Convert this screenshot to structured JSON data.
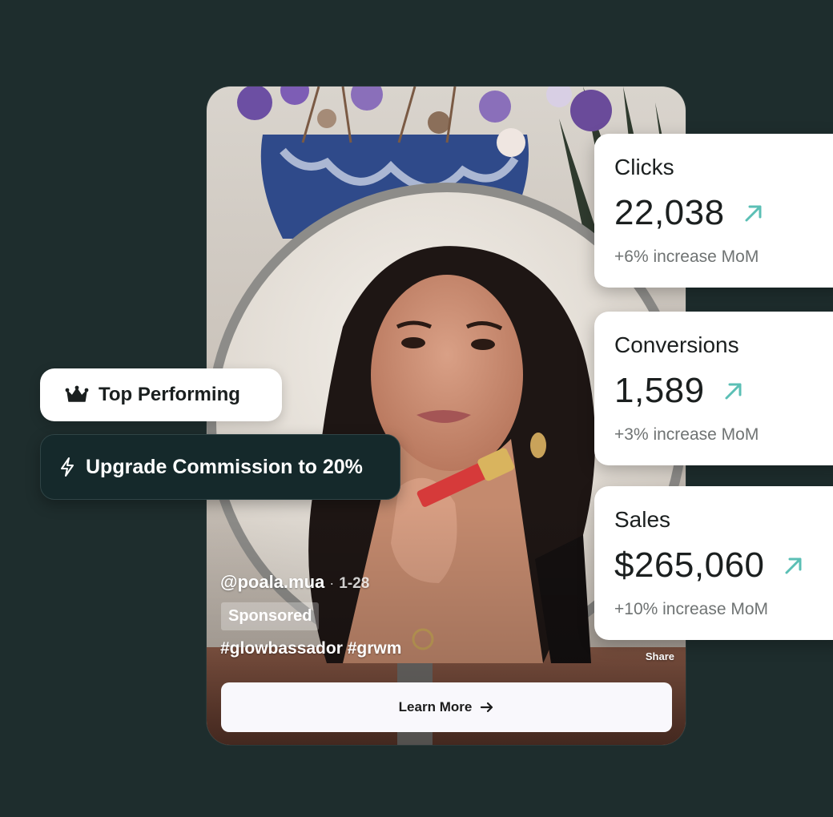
{
  "video": {
    "creator_handle": "@poala.mua",
    "separator": "·",
    "post_date": "1-28",
    "sponsored_label": "Sponsored",
    "hashtags": "#glowbassador #grwm",
    "share_label": "Share",
    "cta_label": "Learn More"
  },
  "badges": {
    "top_performing_label": "Top Performing",
    "upgrade_label": "Upgrade Commission to 20%"
  },
  "stats": [
    {
      "title": "Clicks",
      "value": "22,038",
      "change": "+6% increase MoM"
    },
    {
      "title": "Conversions",
      "value": "1,589",
      "change": "+3% increase MoM"
    },
    {
      "title": "Sales",
      "value": "$265,060",
      "change": "+10% increase MoM"
    }
  ],
  "colors": {
    "page_background": "#1e2d2d",
    "card_background": "#ffffff",
    "trend_up_accent": "#5bbfb5",
    "upgrade_pill_background": "#15292b"
  }
}
